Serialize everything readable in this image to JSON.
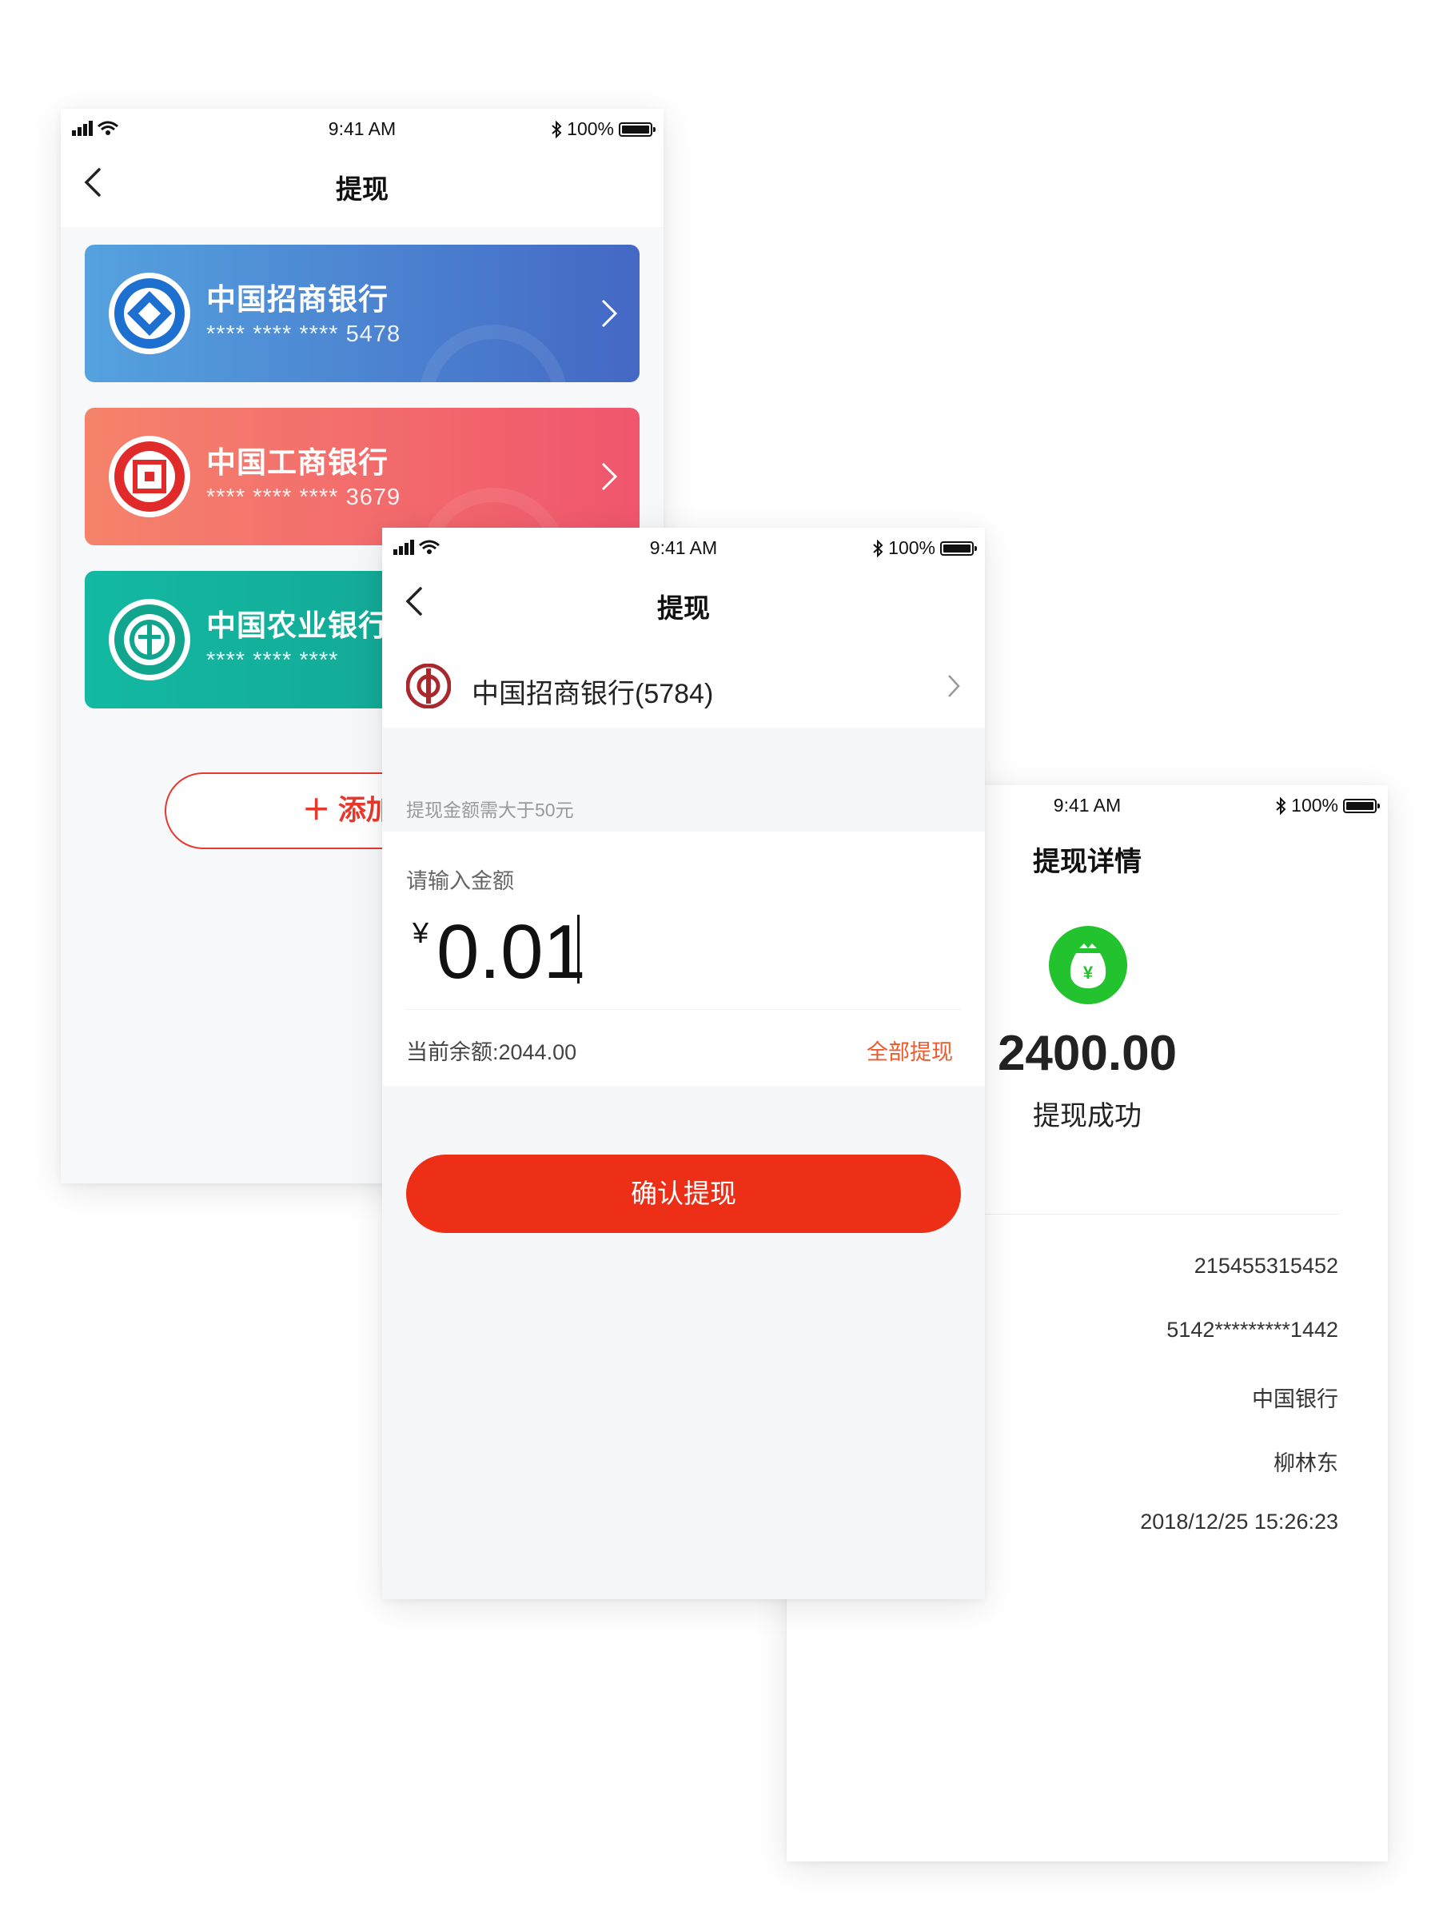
{
  "status": {
    "time": "9:41 AM",
    "battery": "100%"
  },
  "cardList": {
    "title": "提现",
    "cards": [
      {
        "name": "中国招商银行",
        "number": "**** **** **** 5478"
      },
      {
        "name": "中国工商银行",
        "number": "**** **** **** 3679"
      },
      {
        "name": "中国农业银行",
        "number": "**** **** ****"
      }
    ],
    "add_label": "添加银"
  },
  "withdraw": {
    "title": "提现",
    "bank": "中国招商银行(5784)",
    "hint": "提现金额需大于50元",
    "amount_label": "请输入金额",
    "currency": "¥",
    "amount": "0.01",
    "balance": "当前余额:2044.00",
    "withdraw_all": "全部提现",
    "confirm": "确认提现"
  },
  "detail": {
    "title": "提现详情",
    "amount": "2400.00",
    "result": "提现成功",
    "values": [
      "215455315452",
      "5142*********1442",
      "中国银行",
      "柳林东",
      "2018/12/25 15:26:23"
    ]
  },
  "colors": {
    "accent": "#ee2f18",
    "success": "#22c32e"
  }
}
